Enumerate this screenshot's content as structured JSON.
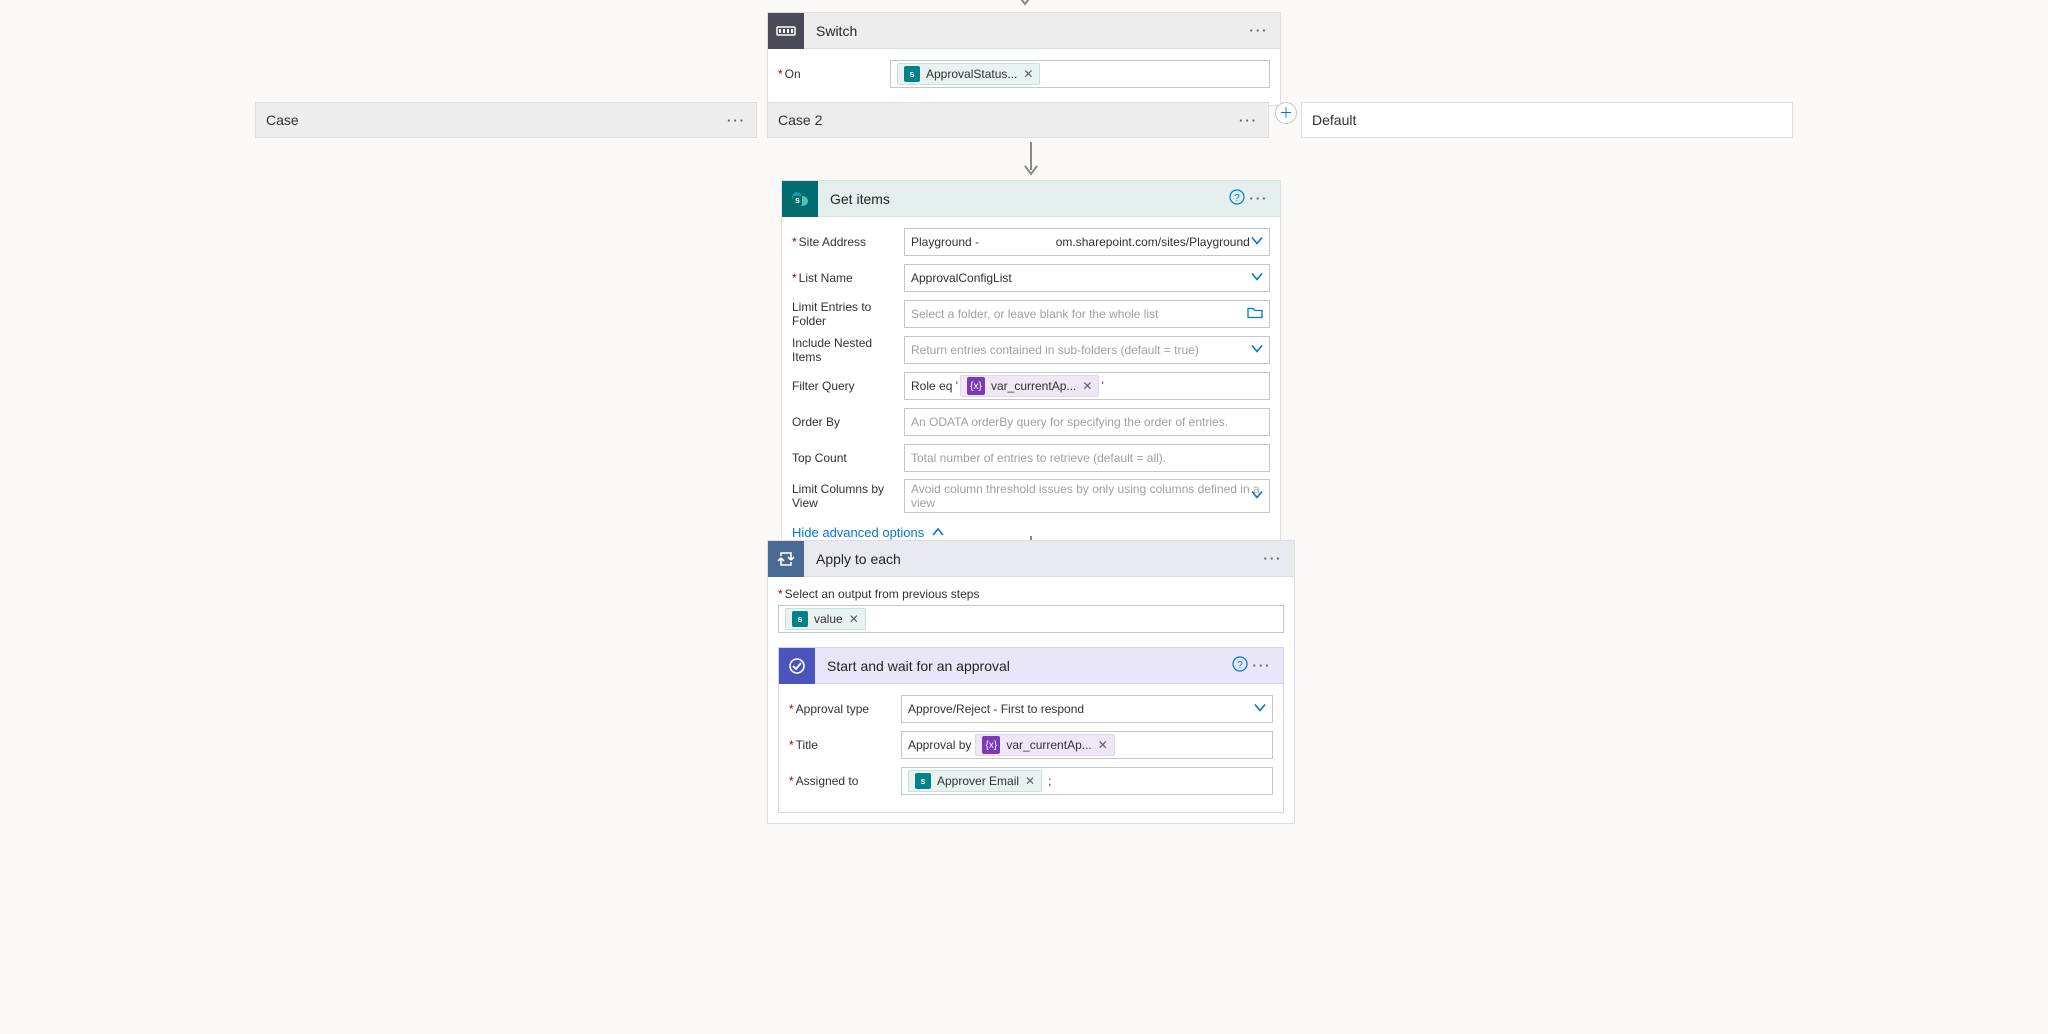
{
  "switch": {
    "title": "Switch",
    "onLabel": "On",
    "token": "ApprovalStatus..."
  },
  "case1": {
    "title": "Case"
  },
  "case2": {
    "title": "Case 2"
  },
  "defaultBranch": {
    "title": "Default"
  },
  "getItems": {
    "title": "Get items",
    "siteAddressLabel": "Site Address",
    "siteAddressValue": "Playground -                       om.sharepoint.com/sites/Playground",
    "listNameLabel": "List Name",
    "listNameValue": "ApprovalConfigList",
    "limitFolderLabel": "Limit Entries to Folder",
    "limitFolderPlaceholder": "Select a folder, or leave blank for the whole list",
    "includeNestedLabel": "Include Nested Items",
    "includeNestedPlaceholder": "Return entries contained in sub-folders (default = true)",
    "filterQueryLabel": "Filter Query",
    "filterQueryPrefix": "Role eq '",
    "filterQueryToken": "var_currentAp...",
    "filterQuerySuffix": "'",
    "orderByLabel": "Order By",
    "orderByPlaceholder": "An ODATA orderBy query for specifying the order of entries.",
    "topCountLabel": "Top Count",
    "topCountPlaceholder": "Total number of entries to retrieve (default = all).",
    "limitColsLabel": "Limit Columns by View",
    "limitColsPlaceholder": "Avoid column threshold issues by only using columns defined in a view",
    "hideAdvanced": "Hide advanced options"
  },
  "applyEach": {
    "title": "Apply to each",
    "selectOutputLabel": "Select an output from previous steps",
    "valueToken": "value"
  },
  "approval": {
    "title": "Start and wait for an approval",
    "typeLabel": "Approval type",
    "typeValue": "Approve/Reject - First to respond",
    "titleLabel": "Title",
    "titlePrefix": "Approval by",
    "titleToken": "var_currentAp...",
    "assignedLabel": "Assigned to",
    "assignedToken": "Approver Email",
    "assignedSuffix": ";"
  }
}
